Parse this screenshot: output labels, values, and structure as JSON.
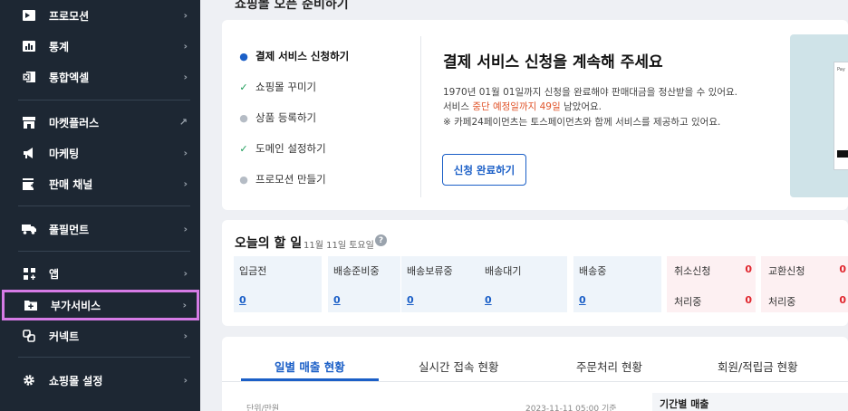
{
  "sidebar": {
    "items": [
      {
        "label": "프로모션",
        "icon": "promotion-icon",
        "chevron": "›"
      },
      {
        "label": "통계",
        "icon": "stats-icon",
        "chevron": "›"
      },
      {
        "label": "통합엑셀",
        "icon": "excel-icon",
        "chevron": "›"
      },
      {
        "label": "마켓플러스",
        "icon": "marketplus-icon",
        "chevron": "↗"
      },
      {
        "label": "마케팅",
        "icon": "megaphone-icon",
        "chevron": "›"
      },
      {
        "label": "판매 채널",
        "icon": "sales-channel-icon",
        "chevron": "›"
      },
      {
        "label": "풀필먼트",
        "icon": "truck-icon",
        "chevron": "›"
      },
      {
        "label": "앱",
        "icon": "apps-icon",
        "chevron": "›"
      },
      {
        "label": "부가서비스",
        "icon": "addon-folder-icon",
        "chevron": "›"
      },
      {
        "label": "커넥트",
        "icon": "connect-icon",
        "chevron": "›"
      },
      {
        "label": "쇼핑몰 설정",
        "icon": "gear-icon",
        "chevron": "›"
      }
    ],
    "active_index": 8
  },
  "onboarding": {
    "section_title": "쇼핑몰 오픈 준비하기",
    "steps": [
      {
        "label": "결제 서비스 신청하기",
        "state": "current"
      },
      {
        "label": "쇼핑몰 꾸미기",
        "state": "done"
      },
      {
        "label": "상품 등록하기",
        "state": "todo"
      },
      {
        "label": "도메인 설정하기",
        "state": "done"
      },
      {
        "label": "프로모션 만들기",
        "state": "todo"
      }
    ],
    "headline": "결제 서비스 신청을 계속해 주세요",
    "line1": "1970년 01월 01일까지 신청을 완료해야 판매대금을 정산받을 수 있어요.",
    "line2_pre": "서비스 ",
    "line2_highlight": "중단 예정일까지 49일",
    "line2_post": " 남았어요.",
    "line3": "※ 카페24페이먼츠는 토스페이먼츠와 함께 서비스를 제공하고 있어요.",
    "button_label": "신청 완료하기",
    "preview_text": "Pay"
  },
  "todo": {
    "title": "오늘의 할 일",
    "date": "11월 11일 토요일",
    "help": "?",
    "stats": [
      {
        "label": "입금전",
        "value": "0"
      },
      {
        "label": "배송준비중",
        "value": "0"
      },
      {
        "label": "배송보류중",
        "value": "0"
      },
      {
        "label": "배송대기",
        "value": "0"
      },
      {
        "label": "배송중",
        "value": "0"
      }
    ],
    "alerts": [
      {
        "label1": "취소신청",
        "value1": "0",
        "label2": "처리중",
        "value2": "0"
      },
      {
        "label1": "교환신청",
        "value1": "0",
        "label2": "처리중",
        "value2": "0"
      }
    ]
  },
  "tabs": {
    "items": [
      "일별 매출 현황",
      "실시간 접속 현황",
      "주문처리 현황",
      "회원/적립금 현황"
    ],
    "active_index": 0
  },
  "sales": {
    "unit": "단위/만원",
    "timestamp": "2023-11-11 05:00 기준",
    "period_header": "기간별 매출"
  },
  "colors": {
    "sidebar_bg": "#1d2733",
    "accent": "#1b5fc7",
    "highlight_outline": "#d67be6",
    "warning": "#e0542a",
    "alert_red": "#e0262e"
  }
}
